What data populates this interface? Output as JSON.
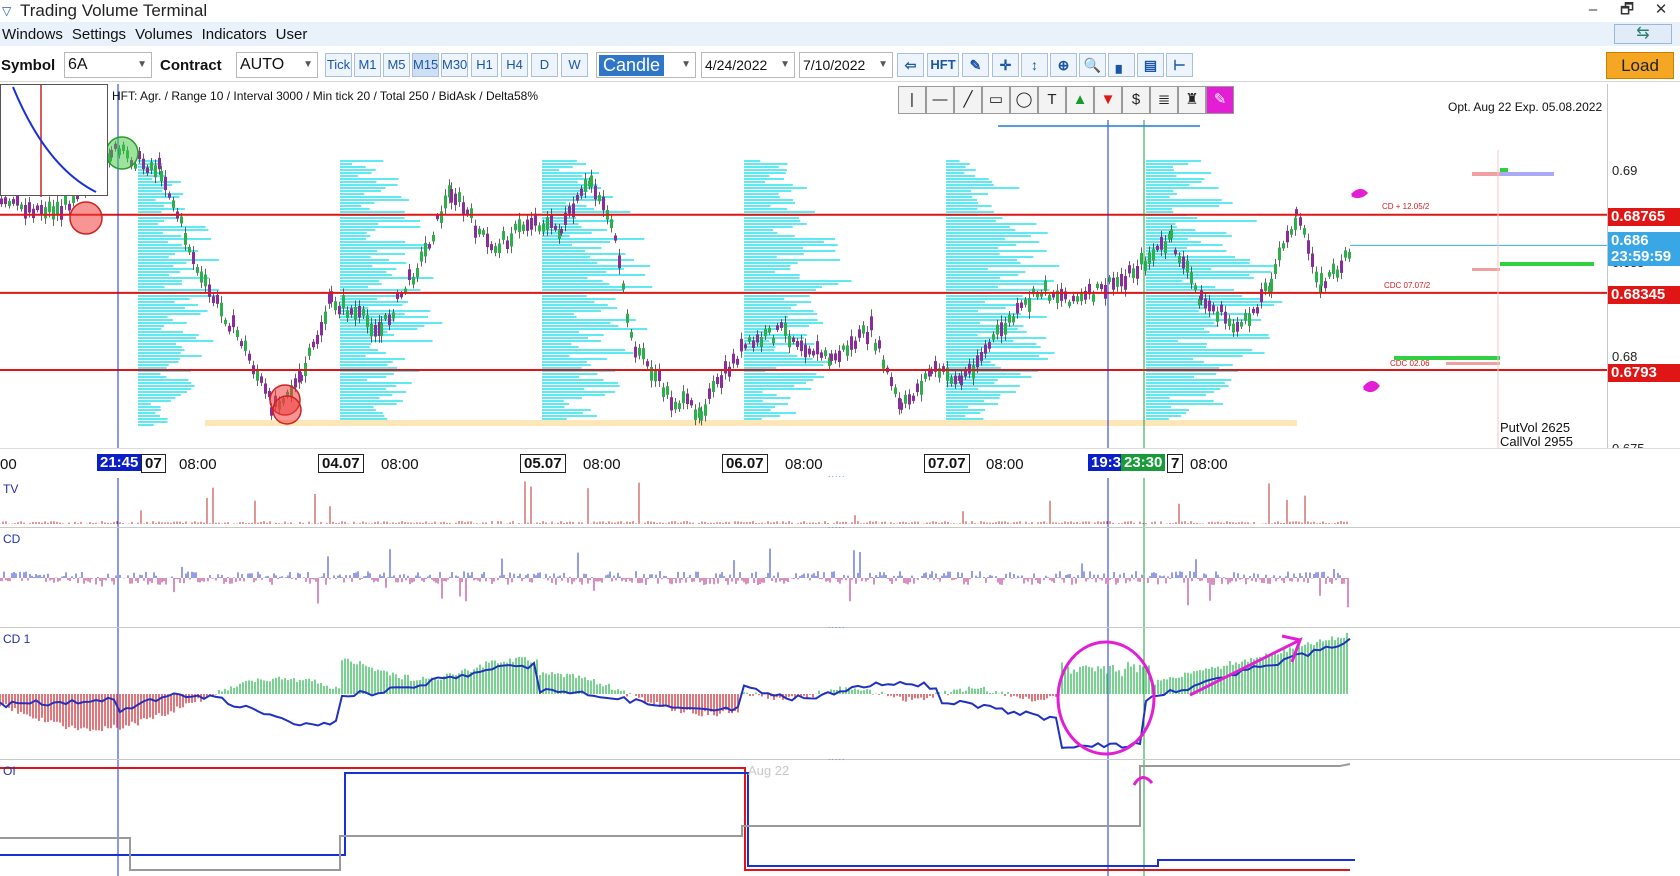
{
  "window": {
    "title": "Trading Volume Terminal",
    "minimize_icon": "minimize-icon",
    "restore_icon": "restore-icon",
    "close_icon": "close-icon"
  },
  "menu": {
    "items": [
      "Windows",
      "Settings",
      "Volumes",
      "Indicators",
      "User"
    ]
  },
  "toolbar": {
    "symbol_label": "Symbol",
    "symbol_value": "6A",
    "contract_label": "Contract",
    "contract_value": "AUTO",
    "timeframes": [
      "Tick",
      "M1",
      "M5",
      "M15",
      "M30",
      "H1",
      "H4",
      "D",
      "W"
    ],
    "active_timeframe": "M15",
    "chart_type": "Candle",
    "date_from": "4/24/2022",
    "date_to": "7/10/2022",
    "hft_label": "HFT",
    "load_label": "Load"
  },
  "chart": {
    "hft_info": "HFT: Agr. / Range 10 / Interval 3000 / Min tick 20 / Total 250 / BidAsk / Delta58%",
    "option_info": "Opt. Aug 22 Exp. 05.08.2022",
    "put_vol": "PutVol  2625",
    "call_vol": "CallVol  2955",
    "notes": [
      "CD + 12.05/2",
      "CDC 07.07/2",
      "CDC 02.06"
    ],
    "price_ticks": [
      "0.69",
      "0.685",
      "0.68",
      "0.675"
    ],
    "price_boxes": [
      {
        "label": "0.68765",
        "color": "#e01515"
      },
      {
        "label": "0.686",
        "color": "#39a6e6"
      },
      {
        "label": "23:59:59",
        "color": "#39a6e6"
      },
      {
        "label": "0.68345",
        "color": "#e01515"
      },
      {
        "label": "0.6793",
        "color": "#e01515"
      }
    ],
    "levels": {
      "red": [
        0.68765,
        0.68345,
        0.6793
      ],
      "current": 0.686
    },
    "time_labels": [
      "00",
      "21:45",
      "07",
      "08:00",
      "04.07",
      "08:00",
      "05.07",
      "08:00",
      "06.07",
      "08:00",
      "07.07",
      "08:00",
      "19:3",
      "23:30",
      "7",
      "08:00"
    ]
  },
  "panels": {
    "tv": "TV",
    "cd": "CD",
    "cd1": "CD 1",
    "oi": "OI",
    "oi_watermark": "Aug 22"
  },
  "colors": {
    "accent": "#1a56a8",
    "red_level": "#e01515",
    "profile": "#36e3f0",
    "magenta": "#e21fd5"
  }
}
